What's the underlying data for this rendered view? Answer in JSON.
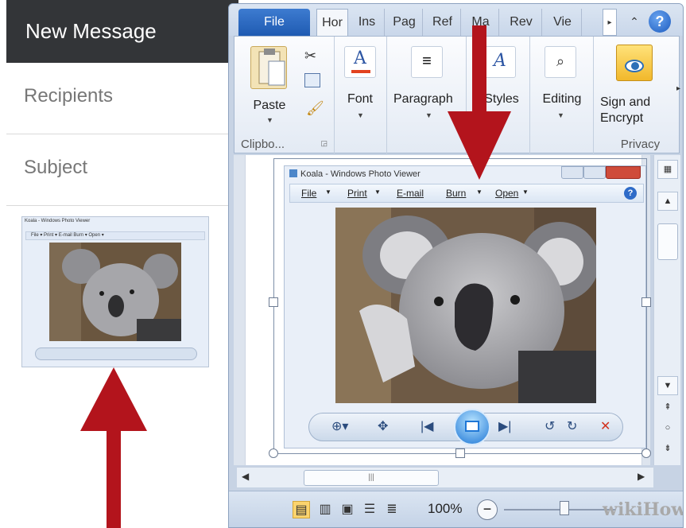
{
  "compose": {
    "title": "New Message",
    "recipients_label": "Recipients",
    "subject_label": "Subject",
    "attachment": {
      "title": "Koala - Windows Photo Viewer",
      "menu": "File  ▾   Print  ▾   E-mail   Burn  ▾   Open  ▾"
    }
  },
  "word": {
    "tabs": {
      "file": "File",
      "home": "Hor",
      "insert": "Ins",
      "page": "Pag",
      "references": "Ref",
      "mailings": "Ma",
      "review": "Rev",
      "view": "Vie"
    },
    "ribbon": {
      "paste_label": "Paste",
      "clipboard_group": "Clipbo...",
      "font_label": "Font",
      "paragraph_label": "Paragraph",
      "styles_label": "Styles",
      "editing_label": "Editing",
      "sign_encrypt_line1": "Sign and",
      "sign_encrypt_line2": "Encrypt",
      "privacy_group": "Privacy"
    },
    "photo_viewer": {
      "title": "Koala - Windows Photo Viewer",
      "menu": {
        "file": "File",
        "print": "Print",
        "email": "E-mail",
        "burn": "Burn",
        "open": "Open"
      }
    },
    "status": {
      "zoom": "100%"
    },
    "watermark": "wikiHow"
  },
  "colors": {
    "arrow": "#b3141c",
    "file_tab": "#1f5bb2",
    "compose_header": "#333538"
  }
}
